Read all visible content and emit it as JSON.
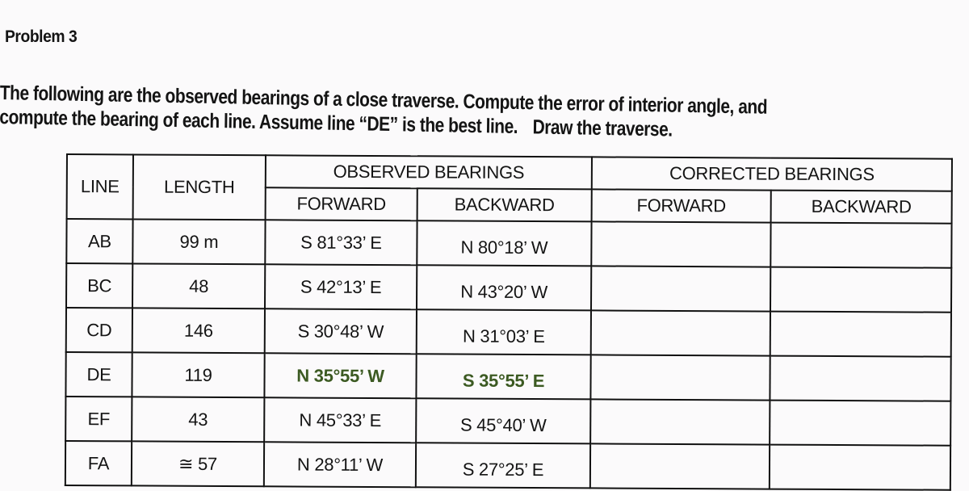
{
  "problem": {
    "title": "Problem 3",
    "instructions_line1": "The following are the observed bearings of a close traverse. Compute the error of interior angle, and",
    "instructions_line2a": "compute the bearing of each line. Assume line “DE” is the best line.",
    "instructions_line2b": "Draw the traverse."
  },
  "table": {
    "headers": {
      "line": "LINE",
      "length": "LENGTH",
      "observed": "OBSERVED BEARINGS",
      "corrected": "CORRECTED BEARINGS",
      "observed_forward": "FORWARD",
      "observed_backward": "BACKWARD",
      "corrected_forward": "FORWARD",
      "corrected_backward": "BACKWARD"
    },
    "rows": [
      {
        "line": "AB",
        "length": "99 m",
        "forward": "S 81°33’ E",
        "backward": "N 80°18’ W",
        "corrected_forward": "",
        "corrected_backward": ""
      },
      {
        "line": "BC",
        "length": "48",
        "forward": "S 42°13’ E",
        "backward": "N 43°20’ W",
        "corrected_forward": "",
        "corrected_backward": ""
      },
      {
        "line": "CD",
        "length": "146",
        "forward": "S 30°48’ W",
        "backward": "N 31°03’ E",
        "corrected_forward": "",
        "corrected_backward": ""
      },
      {
        "line": "DE",
        "length": "119",
        "forward": "N 35°55’ W",
        "backward": "S 35°55’ E",
        "corrected_forward": "",
        "corrected_backward": ""
      },
      {
        "line": "EF",
        "length": "43",
        "forward": "N 45°33’ E",
        "backward": "S 45°40’ W",
        "corrected_forward": "",
        "corrected_backward": ""
      },
      {
        "line": "FA",
        "length": "≅ 57",
        "forward": "N 28°11’ W",
        "backward": "S 27°25’ E",
        "corrected_forward": "",
        "corrected_backward": ""
      }
    ],
    "best_line": "DE",
    "best_line_color": "#3c5a22"
  }
}
